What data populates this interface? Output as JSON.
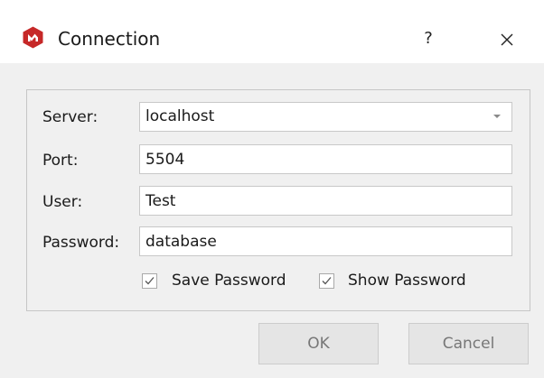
{
  "window": {
    "title": "Connection",
    "help_label": "?",
    "icons": {
      "app": "app-logo-icon",
      "close": "close-icon"
    },
    "accent_color": "#c62828"
  },
  "form": {
    "server": {
      "label": "Server:",
      "value": "localhost",
      "icon": "chevron-down-icon"
    },
    "port": {
      "label": "Port:",
      "value": "5504"
    },
    "user": {
      "label": "User:",
      "value": "Test"
    },
    "password": {
      "label": "Password:",
      "value": "database"
    },
    "save_password": {
      "label": "Save Password",
      "checked": true
    },
    "show_password": {
      "label": "Show Password",
      "checked": true
    }
  },
  "buttons": {
    "ok_label": "OK",
    "cancel_label": "Cancel"
  }
}
